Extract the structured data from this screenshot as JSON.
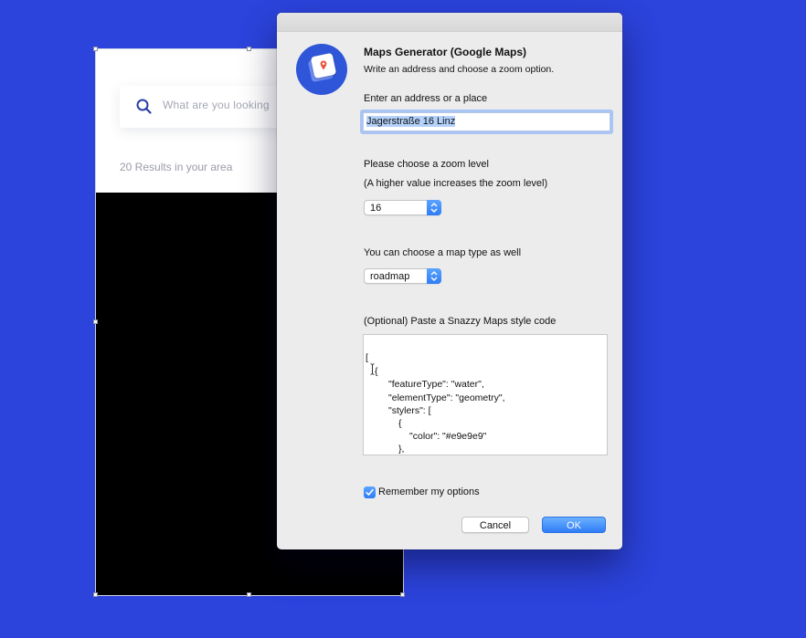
{
  "artboard": {
    "search_placeholder": "What are you looking",
    "results_text": "20 Results in your area"
  },
  "dialog": {
    "title": "Maps Generator (Google Maps)",
    "subtitle": "Write an address and choose a zoom option.",
    "address_label": "Enter an address or a place",
    "address_value": "Jagerstraße 16 Linz",
    "zoom_label": "Please choose a zoom level",
    "zoom_hint": "(A higher value increases the zoom level)",
    "zoom_value": "16",
    "map_type_label": "You can choose a map type as well",
    "map_type_value": "roadmap",
    "style_label": "(Optional) Paste a Snazzy Maps style code",
    "style_code_lines": [
      "[",
      "{",
      "\"featureType\": \"water\",",
      "\"elementType\": \"geometry\",",
      "\"stylers\": [",
      "{",
      "\"color\": \"#e9e9e9\"",
      "},"
    ],
    "remember_label": "Remember my options",
    "remember_checked": true,
    "cancel_label": "Cancel",
    "ok_label": "OK"
  },
  "colors": {
    "background": "#2c43dc",
    "accent": "#2f7cf6",
    "app_icon": "#2f56d8"
  }
}
